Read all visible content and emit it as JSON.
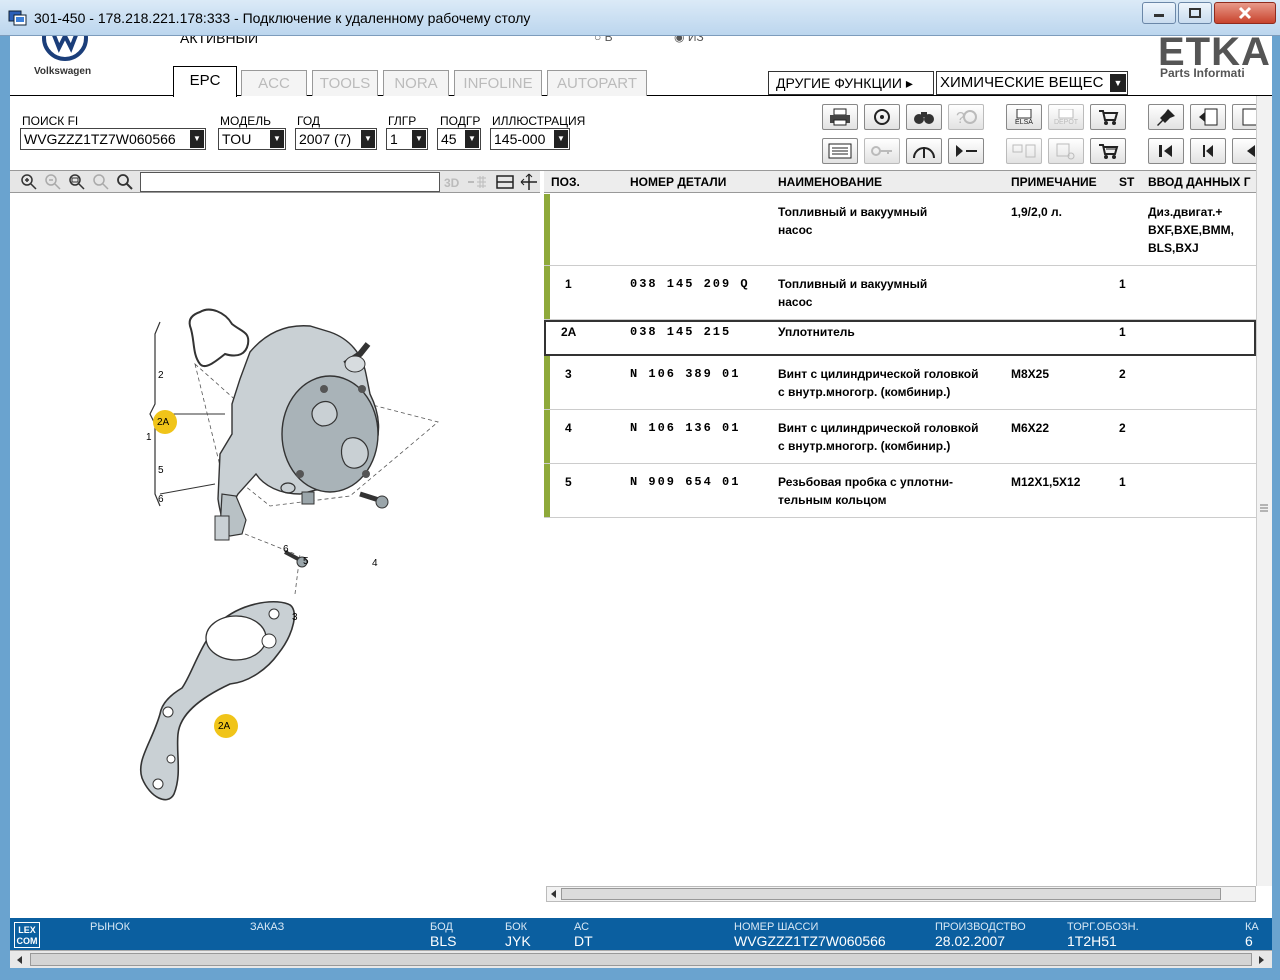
{
  "window": {
    "title": "301-450 - 178.218.221.178:333 - Подключение к удаленному рабочему столу"
  },
  "header": {
    "brand": "Volkswagen",
    "status": "АКТИВНЫЙ",
    "radio_1": "В",
    "radio_2": "ИЗ",
    "tabs": [
      {
        "label": "EPC",
        "active": true
      },
      {
        "label": "ACC"
      },
      {
        "label": "TOOLS"
      },
      {
        "label": "NORA"
      },
      {
        "label": "INFOLINE"
      },
      {
        "label": "AUTOPART"
      }
    ],
    "other_functions": "ДРУГИЕ ФУНКЦИИ ▸",
    "chemicals": "ХИМИЧЕСКИЕ ВЕЩЕС",
    "etka_logo": "ETKA",
    "etka_sub": "Parts Informati"
  },
  "filters": {
    "fi_label": "ПОИСК FI",
    "fi_value": "WVGZZZ1TZ7W060566",
    "model_label": "МОДЕЛЬ",
    "model_value": "TOU",
    "year_label": "ГОД",
    "year_value": "2007 (7)",
    "mg_label": "ГЛГР",
    "mg_value": "1",
    "sg_label": "ПОДГР",
    "sg_value": "45",
    "ill_label": "ИЛЛЮСТРАЦИЯ",
    "ill_value": "145-000"
  },
  "toolbar": {
    "elsa": "ELSA",
    "depot": "DEPOT"
  },
  "grid": {
    "headers": {
      "pos": "ПОЗ.",
      "part": "НОМЕР ДЕТАЛИ",
      "name": "НАИМЕНОВАНИЕ",
      "note": "ПРИМЕЧАНИЕ",
      "st": "ST",
      "input": "ВВОД ДАННЫХ Г"
    },
    "rows": [
      {
        "pos": "",
        "part": "",
        "name": "Топливный и вакуумный\nнасос",
        "note": "1,9/2,0 л.",
        "st": "",
        "input": "Диз.двигат.+\nBXF,BXE,BMM,\nBLS,BXJ"
      },
      {
        "pos": "1",
        "part": "038 145 209 Q",
        "name": "Топливный и вакуумный\nнасос",
        "note": "",
        "st": "1",
        "input": ""
      },
      {
        "pos": "2A",
        "part": "038 145 215",
        "name": "Уплотнитель",
        "note": "",
        "st": "1",
        "input": ""
      },
      {
        "pos": "3",
        "part": "N   106 389 01",
        "name": "Винт с цилиндрической головкой\nс внутр.многогр. (комбинир.)",
        "note": "M8X25",
        "st": "2",
        "input": ""
      },
      {
        "pos": "4",
        "part": "N   106 136 01",
        "name": "Винт с цилиндрической головкой\nс внутр.многогр. (комбинир.)",
        "note": "M6X22",
        "st": "2",
        "input": ""
      },
      {
        "pos": "5",
        "part": "N   909 654 01",
        "name": "Резьбовая пробка с уплотни-\nтельным кольцом",
        "note": "M12X1,5X12",
        "st": "1",
        "input": ""
      }
    ]
  },
  "illustration": {
    "callouts": [
      "2",
      "2A",
      "1",
      "5",
      "6",
      "6",
      "5",
      "4",
      "3",
      "2A"
    ]
  },
  "status": {
    "lexcom": "LEX\nCOM",
    "market_label": "РЫНОК",
    "market_value": "",
    "order_label": "ЗАКАЗ",
    "order_value": "",
    "bod_label": "БОД",
    "bod_value": "BLS",
    "bok_label": "БОК",
    "bok_value": "JYK",
    "ac_label": "АС",
    "ac_value": "DT",
    "chassis_label": "НОМЕР ШАССИ",
    "chassis_value": "WVGZZZ1TZ7W060566",
    "prod_label": "ПРОИЗВОДСТВО",
    "prod_value": "28.02.2007",
    "trade_label": "ТОРГ.ОБОЗН.",
    "trade_value": "1T2H51",
    "ka_label": "КА",
    "ka_value": "6"
  },
  "colors": {
    "status_bg": "#0b5fa0",
    "row_marker": "#8ea93a",
    "callout_yellow": "#f0c419"
  }
}
